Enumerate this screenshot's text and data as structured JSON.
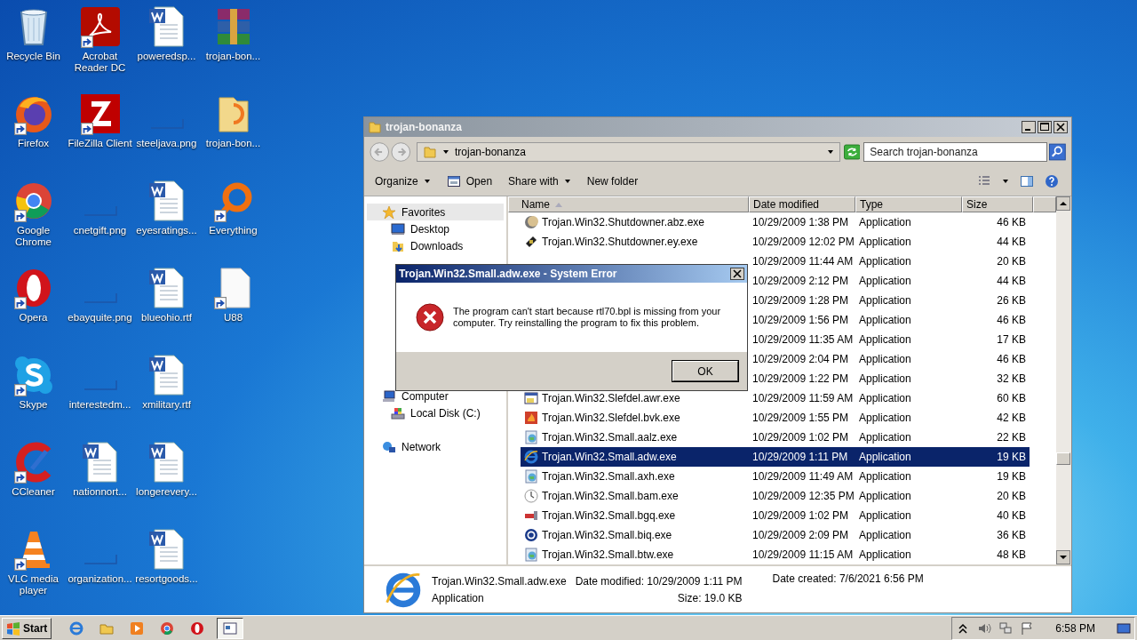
{
  "desktop_icons": [
    {
      "label": "Recycle Bin",
      "kind": "recycle",
      "shortcut": false
    },
    {
      "label": "Firefox",
      "kind": "firefox",
      "shortcut": true
    },
    {
      "label": "Google Chrome",
      "kind": "chrome",
      "shortcut": true
    },
    {
      "label": "Opera",
      "kind": "opera",
      "shortcut": true
    },
    {
      "label": "Skype",
      "kind": "skype",
      "shortcut": true
    },
    {
      "label": "CCleaner",
      "kind": "ccleaner",
      "shortcut": true
    },
    {
      "label": "VLC media player",
      "kind": "vlc",
      "shortcut": true
    },
    {
      "label": "Acrobat Reader DC",
      "kind": "acrobat",
      "shortcut": true
    },
    {
      "label": "FileZilla Client",
      "kind": "filezilla",
      "shortcut": true
    },
    {
      "label": "cnetgift.png",
      "kind": "png",
      "shortcut": false
    },
    {
      "label": "ebayquite.png",
      "kind": "png",
      "shortcut": false
    },
    {
      "label": "interestedm...",
      "kind": "png",
      "shortcut": false
    },
    {
      "label": "nationnort...",
      "kind": "word",
      "shortcut": false
    },
    {
      "label": "organization...",
      "kind": "png",
      "shortcut": false
    },
    {
      "label": "poweredsp...",
      "kind": "word",
      "shortcut": false
    },
    {
      "label": "steeljava.png",
      "kind": "png",
      "shortcut": false
    },
    {
      "label": "eyesratings...",
      "kind": "word",
      "shortcut": false
    },
    {
      "label": "blueohio.rtf",
      "kind": "word",
      "shortcut": false
    },
    {
      "label": "xmilitary.rtf",
      "kind": "word",
      "shortcut": false
    },
    {
      "label": "longerevery...",
      "kind": "word",
      "shortcut": false
    },
    {
      "label": "resortgoods...",
      "kind": "word",
      "shortcut": false
    },
    {
      "label": "trojan-bon...",
      "kind": "archive",
      "shortcut": false
    },
    {
      "label": "trojan-bon...",
      "kind": "folder",
      "shortcut": false
    },
    {
      "label": "Everything",
      "kind": "everything",
      "shortcut": true
    },
    {
      "label": "U88",
      "kind": "blank",
      "shortcut": true
    }
  ],
  "explorer": {
    "title": "trojan-bonanza",
    "address": "trojan-bonanza",
    "search": {
      "placeholder": "Search trojan-bonanza"
    },
    "toolbar": [
      {
        "label": "Organize",
        "kind": "menu"
      },
      {
        "label": "Open",
        "kind": "open"
      },
      {
        "label": "Share with",
        "kind": "menu"
      },
      {
        "label": "New folder",
        "kind": "plain"
      }
    ],
    "sidebar": [
      {
        "label": "Favorites",
        "kind": "favorites",
        "selected": true,
        "children": [
          {
            "label": "Desktop",
            "kind": "desktop",
            "selected": false
          },
          {
            "label": "Downloads",
            "kind": "downloads",
            "selected": false
          }
        ]
      },
      {
        "label": "Computer",
        "kind": "computer",
        "selected": false,
        "children": [
          {
            "label": "Local Disk (C:)",
            "kind": "disk",
            "selected": false
          }
        ]
      },
      {
        "label": "Network",
        "kind": "network",
        "selected": false
      }
    ],
    "columns": [
      {
        "label": "Name",
        "sorted": true
      },
      {
        "label": "Date modified",
        "sorted": false
      },
      {
        "label": "Type",
        "sorted": false
      },
      {
        "label": "Size",
        "sorted": false
      }
    ],
    "rows": [
      {
        "name": "Trojan.Win32.Shutdowner.abz.exe",
        "date": "10/29/2009 1:38 PM",
        "type": "Application",
        "size": "46 KB",
        "selected": false
      },
      {
        "name": "Trojan.Win32.Shutdowner.ey.exe",
        "date": "10/29/2009 12:02 PM",
        "type": "Application",
        "size": "44 KB",
        "selected": false
      },
      {
        "date": "10/29/2009 11:44 AM",
        "type": "Application",
        "size": "20 KB",
        "selected": false
      },
      {
        "date": "10/29/2009 2:12 PM",
        "type": "Application",
        "size": "44 KB",
        "selected": false
      },
      {
        "date": "10/29/2009 1:28 PM",
        "type": "Application",
        "size": "26 KB",
        "selected": false
      },
      {
        "date": "10/29/2009 1:56 PM",
        "type": "Application",
        "size": "46 KB",
        "selected": false
      },
      {
        "date": "10/29/2009 11:35 AM",
        "type": "Application",
        "size": "17 KB",
        "selected": false
      },
      {
        "date": "10/29/2009 2:04 PM",
        "type": "Application",
        "size": "46 KB",
        "selected": false
      },
      {
        "date": "10/29/2009 1:22 PM",
        "type": "Application",
        "size": "32 KB",
        "selected": false
      },
      {
        "name": "Trojan.Win32.Slefdel.awr.exe",
        "date": "10/29/2009 11:59 AM",
        "type": "Application",
        "size": "60 KB",
        "selected": false
      },
      {
        "name": "Trojan.Win32.Slefdel.bvk.exe",
        "date": "10/29/2009 1:55 PM",
        "type": "Application",
        "size": "42 KB",
        "selected": false
      },
      {
        "name": "Trojan.Win32.Small.aalz.exe",
        "date": "10/29/2009 1:02 PM",
        "type": "Application",
        "size": "22 KB",
        "selected": false
      },
      {
        "name": "Trojan.Win32.Small.adw.exe",
        "date": "10/29/2009 1:11 PM",
        "type": "Application",
        "size": "19 KB",
        "selected": true
      },
      {
        "name": "Trojan.Win32.Small.axh.exe",
        "date": "10/29/2009 11:49 AM",
        "type": "Application",
        "size": "19 KB",
        "selected": false
      },
      {
        "name": "Trojan.Win32.Small.bam.exe",
        "date": "10/29/2009 12:35 PM",
        "type": "Application",
        "size": "20 KB",
        "selected": false
      },
      {
        "name": "Trojan.Win32.Small.bgq.exe",
        "date": "10/29/2009 1:02 PM",
        "type": "Application",
        "size": "40 KB",
        "selected": false
      },
      {
        "name": "Trojan.Win32.Small.biq.exe",
        "date": "10/29/2009 2:09 PM",
        "type": "Application",
        "size": "36 KB",
        "selected": false
      },
      {
        "name": "Trojan.Win32.Small.btw.exe",
        "date": "10/29/2009 11:15 AM",
        "type": "Application",
        "size": "48 KB",
        "selected": false
      }
    ],
    "details": {
      "name": "Trojan.Win32.Small.adw.exe",
      "type": "Application",
      "modified": "Date modified: 10/29/2009 1:11 PM",
      "size": "Size: 19.0 KB",
      "created": "Date created: 7/6/2021 6:56 PM"
    }
  },
  "dialog": {
    "title": "Trojan.Win32.Small.adw.exe - System Error",
    "message": "The program can't start because rtl70.bpl is missing from your computer. Try reinstalling the program to fix this problem.",
    "button": "OK"
  },
  "taskbar": {
    "start": "Start",
    "apps": [
      {
        "kind": "ie",
        "active": false
      },
      {
        "kind": "explorer",
        "active": false
      },
      {
        "kind": "media",
        "active": false
      },
      {
        "kind": "chrome",
        "active": false
      },
      {
        "kind": "opera",
        "active": false
      },
      {
        "kind": "window",
        "active": true
      }
    ],
    "time": "6:58 PM"
  }
}
